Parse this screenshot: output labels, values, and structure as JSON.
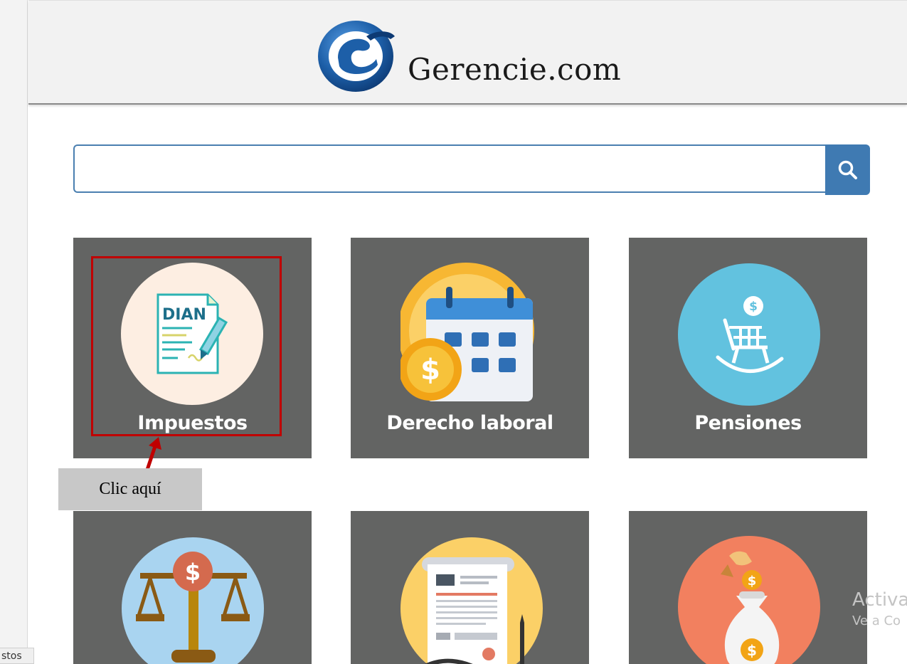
{
  "header": {
    "site_name": "Gerencie.com",
    "logo_icon": "gerencie-g-logo",
    "colors": {
      "logo_blue": "#1d5fa8",
      "header_bg": "#f2f2f2"
    }
  },
  "search": {
    "value": "",
    "button_icon": "search-icon",
    "colors": {
      "border": "#4a7fb0",
      "button": "#3f7ab2"
    }
  },
  "tiles": [
    {
      "label": "Impuestos",
      "icon": "dian-document-icon"
    },
    {
      "label": "Derecho laboral",
      "icon": "calendar-coin-icon"
    },
    {
      "label": "Pensiones",
      "icon": "rocking-chair-icon"
    },
    {
      "label": "",
      "icon": "scale-dollar-icon"
    },
    {
      "label": "",
      "icon": "contract-document-icon"
    },
    {
      "label": "",
      "icon": "money-bag-icon"
    }
  ],
  "annotation": {
    "callout_text": "Clic aquí",
    "highlight_color": "#c00000"
  },
  "dian_badge": "DIAN",
  "watermark": {
    "line1": "Activa",
    "line2": "Ve a Co"
  },
  "status_tab": "stos",
  "colors": {
    "tile_bg": "#636463",
    "tile_label": "#ffffff"
  }
}
